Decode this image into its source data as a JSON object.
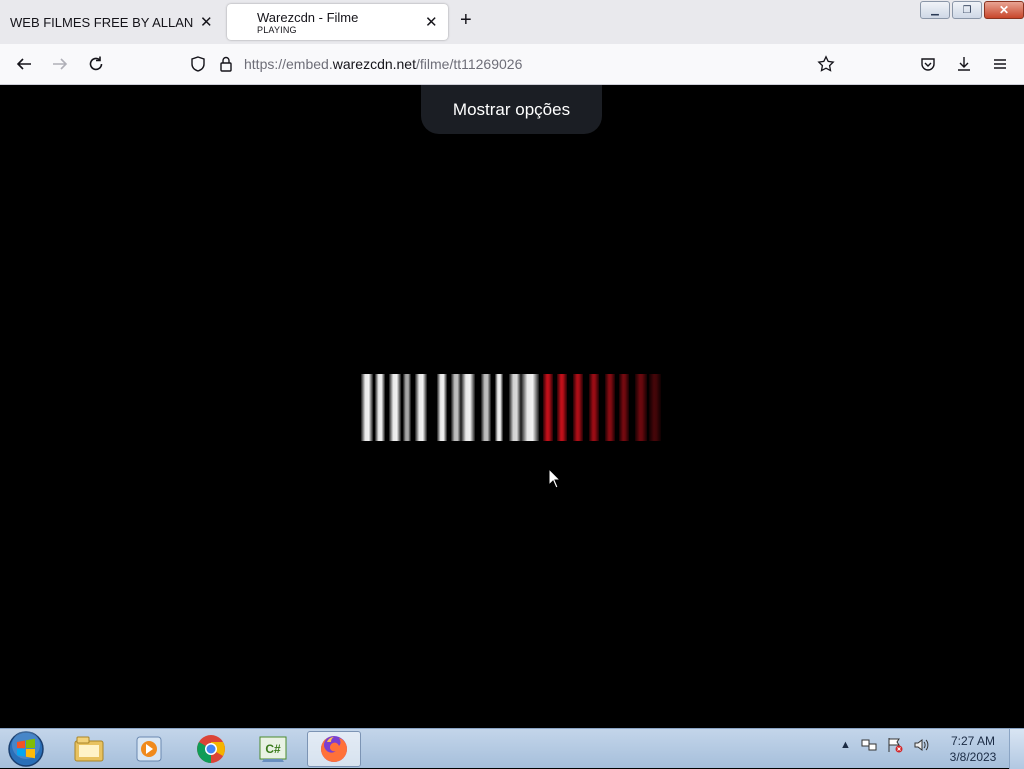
{
  "browser": {
    "tabs": [
      {
        "title": "WEB FILMES FREE BY ALLAN",
        "subtitle": ""
      },
      {
        "title": "Warezcdn - Filme",
        "subtitle": "PLAYING"
      }
    ],
    "url_prefix": "https://embed.",
    "url_domain": "warezcdn.net",
    "url_path": "/filme/tt11269026"
  },
  "page": {
    "options_button": "Mostrar opções"
  },
  "taskbar": {
    "time": "7:27 AM",
    "date": "3/8/2023"
  },
  "colors": {
    "loader_white": "#e6e6e6",
    "loader_red": "#c4101a",
    "page_bg": "#000000",
    "options_bg": "#1b1e24"
  }
}
